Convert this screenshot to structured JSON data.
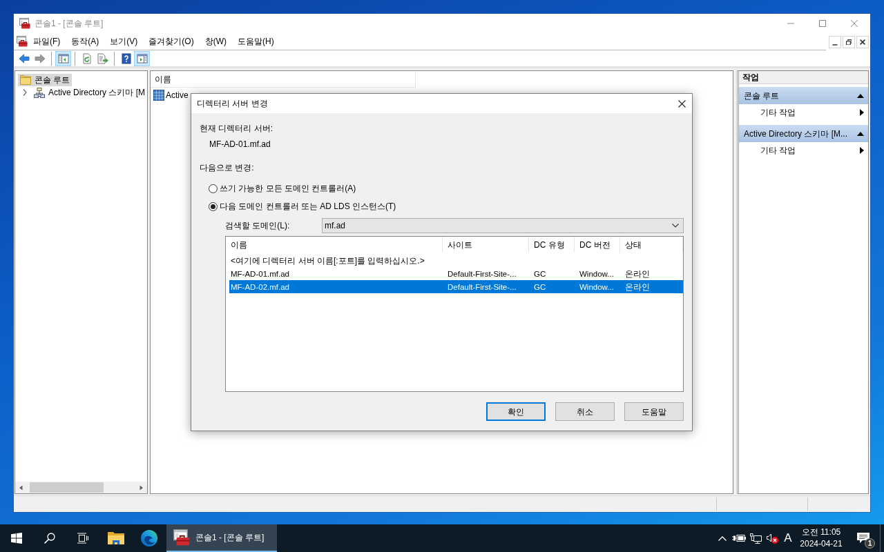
{
  "window": {
    "title": "콘솔1 - [콘솔 루트]"
  },
  "menu": [
    "파일(F)",
    "동작(A)",
    "보기(V)",
    "즐겨찾기(O)",
    "창(W)",
    "도움말(H)"
  ],
  "toolbar": [
    [
      {
        "kind": "back",
        "pressed": false,
        "disabled": false
      },
      {
        "kind": "forward",
        "pressed": false,
        "disabled": true
      }
    ],
    [
      {
        "kind": "console_tree",
        "pressed": true,
        "disabled": false
      }
    ],
    [
      {
        "kind": "refresh",
        "pressed": false,
        "disabled": false
      },
      {
        "kind": "export",
        "pressed": false,
        "disabled": false
      }
    ],
    [
      {
        "kind": "help",
        "pressed": false,
        "disabled": false
      },
      {
        "kind": "action_pane",
        "pressed": true,
        "disabled": false
      }
    ]
  ],
  "tree": [
    {
      "label": "콘솔 루트",
      "selected": true,
      "children": [
        {
          "label": "Active Directory 스키마 [M",
          "selected": false,
          "expanded": false
        }
      ]
    }
  ],
  "list_pane": {
    "columns": [
      "이름"
    ],
    "items": [
      {
        "label": "Active"
      }
    ]
  },
  "actions": {
    "title": "작업",
    "sections": [
      {
        "title": "콘솔 루트",
        "expanded": true,
        "items": [
          "기타 작업"
        ]
      },
      {
        "title": "Active Directory 스키마 [M...",
        "expanded": true,
        "items": [
          "기타 작업"
        ]
      }
    ]
  },
  "dialog": {
    "title": "디렉터리 서버 변경",
    "current_label": "현재 디렉터리 서버:",
    "current_value": "MF-AD-01.mf.ad",
    "change_label": "다음으로 변경:",
    "options": [
      {
        "label": "쓰기 가능한 모든 도메인 컨트롤러(A)",
        "selected": false
      },
      {
        "label": "다음 도메인 컨트롤러 또는 AD LDS 인스턴스(T)",
        "selected": true
      }
    ],
    "domain_label": "검색할 도메인(L):",
    "domain_value": "mf.ad",
    "columns": [
      "이름",
      "사이트",
      "DC 유형",
      "DC 버전",
      "상태"
    ],
    "hint_row": "<여기에 디렉터리 서버 이름[:포트]를 입력하십시오.>",
    "rows": [
      {
        "cells": [
          "MF-AD-01.mf.ad",
          "Default-First-Site-...",
          "GC",
          "Window...",
          "온라인"
        ],
        "selected": false
      },
      {
        "cells": [
          "MF-AD-02.mf.ad",
          "Default-First-Site-...",
          "GC",
          "Window...",
          "온라인"
        ],
        "selected": true
      }
    ],
    "buttons": [
      {
        "label": "확인",
        "default": true
      },
      {
        "label": "취소",
        "default": false
      },
      {
        "label": "도움말",
        "default": false
      }
    ]
  },
  "taskbar": {
    "apps": [
      {
        "kind": "explorer",
        "active": false
      },
      {
        "kind": "edge",
        "active": false
      },
      {
        "kind": "mmc",
        "label": "콘솔1 - [콘솔 루트]",
        "active": true
      }
    ],
    "ime": "A",
    "time": "오전 11:05",
    "date": "2024-04-21",
    "notification_count": "1"
  }
}
